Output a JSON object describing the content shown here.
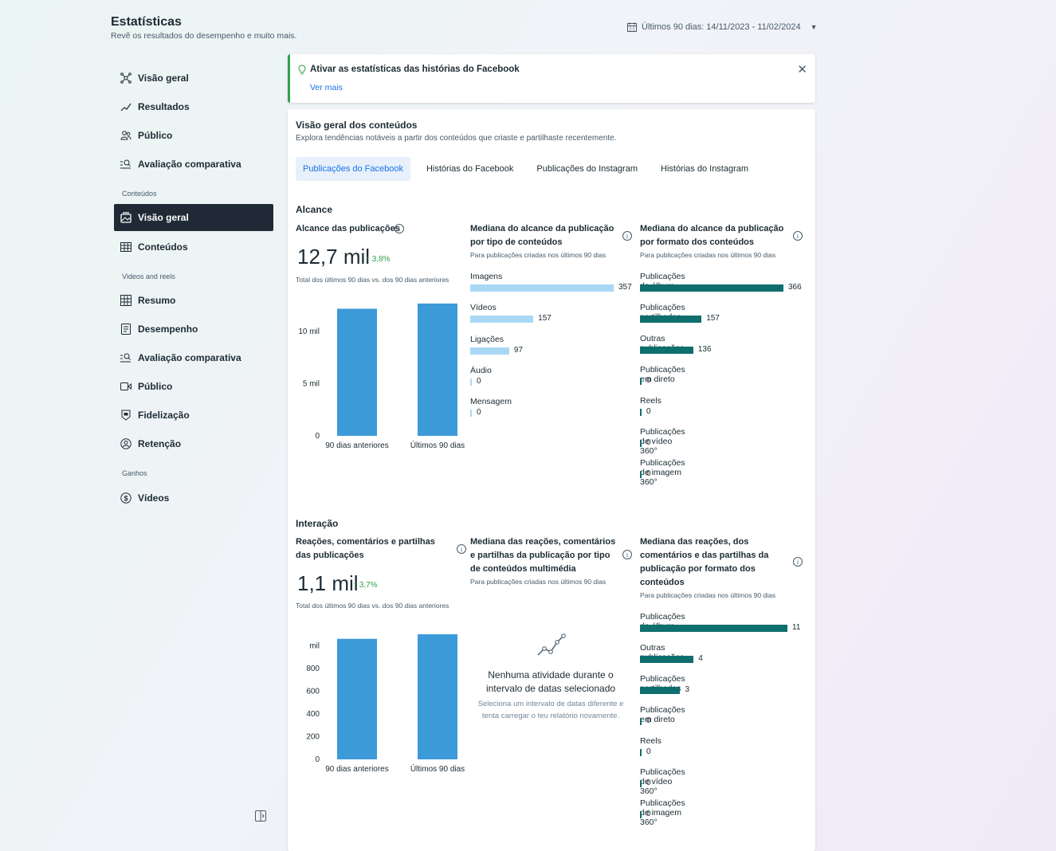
{
  "header": {
    "title": "Estatísticas",
    "subtitle": "Revê os resultados do desempenho e muito mais.",
    "date_range": "Últimos 90 dias: 14/11/2023 - 11/02/2024"
  },
  "sidebar": {
    "items_top": [
      {
        "label": "Visão geral",
        "icon": "network-icon"
      },
      {
        "label": "Resultados",
        "icon": "trend-icon"
      },
      {
        "label": "Público",
        "icon": "people-icon"
      },
      {
        "label": "Avaliação comparativa",
        "icon": "compare-icon"
      }
    ],
    "section_conteudos": "Conteúdos",
    "items_conteudos": [
      {
        "label": "Visão geral",
        "icon": "gallery-icon",
        "active": true
      },
      {
        "label": "Conteúdos",
        "icon": "table-icon"
      }
    ],
    "section_videos": "Videos and reels",
    "items_videos": [
      {
        "label": "Resumo",
        "icon": "grid-icon"
      },
      {
        "label": "Desempenho",
        "icon": "document-icon"
      },
      {
        "label": "Avaliação comparativa",
        "icon": "compare-icon"
      },
      {
        "label": "Público",
        "icon": "video-icon"
      },
      {
        "label": "Fidelização",
        "icon": "badge-icon"
      },
      {
        "label": "Retenção",
        "icon": "person-circle-icon"
      }
    ],
    "section_ganhos": "Ganhos",
    "items_ganhos": [
      {
        "label": "Vídeos",
        "icon": "dollar-icon"
      }
    ]
  },
  "banner": {
    "title": "Ativar as estatísticas das histórias do Facebook",
    "link": "Ver mais"
  },
  "overview": {
    "title": "Visão geral dos conteúdos",
    "subtitle": "Explora tendências notáveis a partir dos conteúdos que criaste e partilhaste recentemente.",
    "tabs": [
      "Publicações do Facebook",
      "Histórias do Facebook",
      "Publicações do Instagram",
      "Histórias do Instagram"
    ]
  },
  "alcance": {
    "section": "Alcance",
    "col1_title": "Alcance das publicações",
    "value": "12,7 mil",
    "delta": "↑ 3,8%",
    "note": "Total dos últimos 90 dias vs. dos 90 dias anteriores",
    "col2_title": "Mediana do alcance da publicação por tipo de conteúdos",
    "col2_note": "Para publicações criadas nos últimos 90 dias",
    "col3_title": "Mediana do alcance da publicação por formato dos conteúdos",
    "col3_note": "Para publicações criadas nos últimos 90 dias"
  },
  "interacao": {
    "section": "Interação",
    "col1_title": "Reações, comentários e partilhas das publicações",
    "value": "1,1 mil",
    "delta": "↑ 3,7%",
    "note": "Total dos últimos 90 dias vs. dos 90 dias anteriores",
    "col2_title": "Mediana das reações, comentários e partilhas da publicação por tipo de conteúdos multimédia",
    "col2_note": "Para publicações criadas nos últimos 90 dias",
    "col3_title": "Mediana das reações, dos comentários e das partilhas da publicação por formato dos conteúdos",
    "col3_note": "Para publicações criadas nos últimos 90 dias",
    "empty_title": "Nenhuma atividade durante o intervalo de datas selecionado",
    "empty_sub": "Seleciona um intervalo de datas diferente e tenta carregar o teu relatório novamente."
  },
  "colors": {
    "bar_blue": "#3d9ad9",
    "bar_light": "#a9d8f5",
    "bar_teal": "#0f6e6e",
    "accent": "#1a73e8",
    "positive": "#31a24c"
  },
  "chart_data": [
    {
      "type": "bar",
      "categories": [
        "90 dias anteriores",
        "Últimos 90 dias"
      ],
      "values": [
        12200,
        12700
      ],
      "ytick_labels": [
        "0",
        "5 mil",
        "10 mil"
      ],
      "ytick_values": [
        0,
        5000,
        10000
      ],
      "ylim": [
        0,
        13000
      ]
    },
    {
      "type": "bar",
      "orientation": "horizontal",
      "categories": [
        "Imagens",
        "Vídeos",
        "Ligações",
        "Áudio",
        "Mensagem"
      ],
      "values": [
        357,
        157,
        97,
        0,
        0
      ],
      "labels": [
        "357",
        "157",
        "97",
        "0",
        "0"
      ]
    },
    {
      "type": "bar",
      "orientation": "horizontal",
      "categories": [
        "Publicações de álbum",
        "Publicações partilhadas",
        "Outras publicações",
        "Publicações em direto",
        "Reels",
        "Publicações de vídeo 360°",
        "Publicações de imagem 360°"
      ],
      "values": [
        366,
        157,
        136,
        0,
        0,
        0,
        0
      ],
      "labels": [
        "366",
        "157",
        "136",
        "0",
        "0",
        "0",
        "0"
      ]
    },
    {
      "type": "bar",
      "categories": [
        "90 dias anteriores",
        "Últimos 90 dias"
      ],
      "values": [
        1060,
        1100
      ],
      "ytick_labels": [
        "0",
        "200",
        "400",
        "600",
        "800",
        "mil"
      ],
      "ytick_values": [
        0,
        200,
        400,
        600,
        800,
        1000
      ],
      "ylim": [
        0,
        1100
      ]
    },
    {
      "type": "bar",
      "orientation": "horizontal",
      "categories": [
        "Publicações de álbum",
        "Outras publicações",
        "Publicações partilhadas",
        "Publicações em direto",
        "Reels",
        "Publicações de vídeo 360°",
        "Publicações de imagem 360°"
      ],
      "values": [
        11,
        4,
        3,
        0,
        0,
        0,
        0
      ],
      "labels": [
        "11",
        "4",
        "3",
        "0",
        "0",
        "0",
        "0"
      ]
    }
  ]
}
